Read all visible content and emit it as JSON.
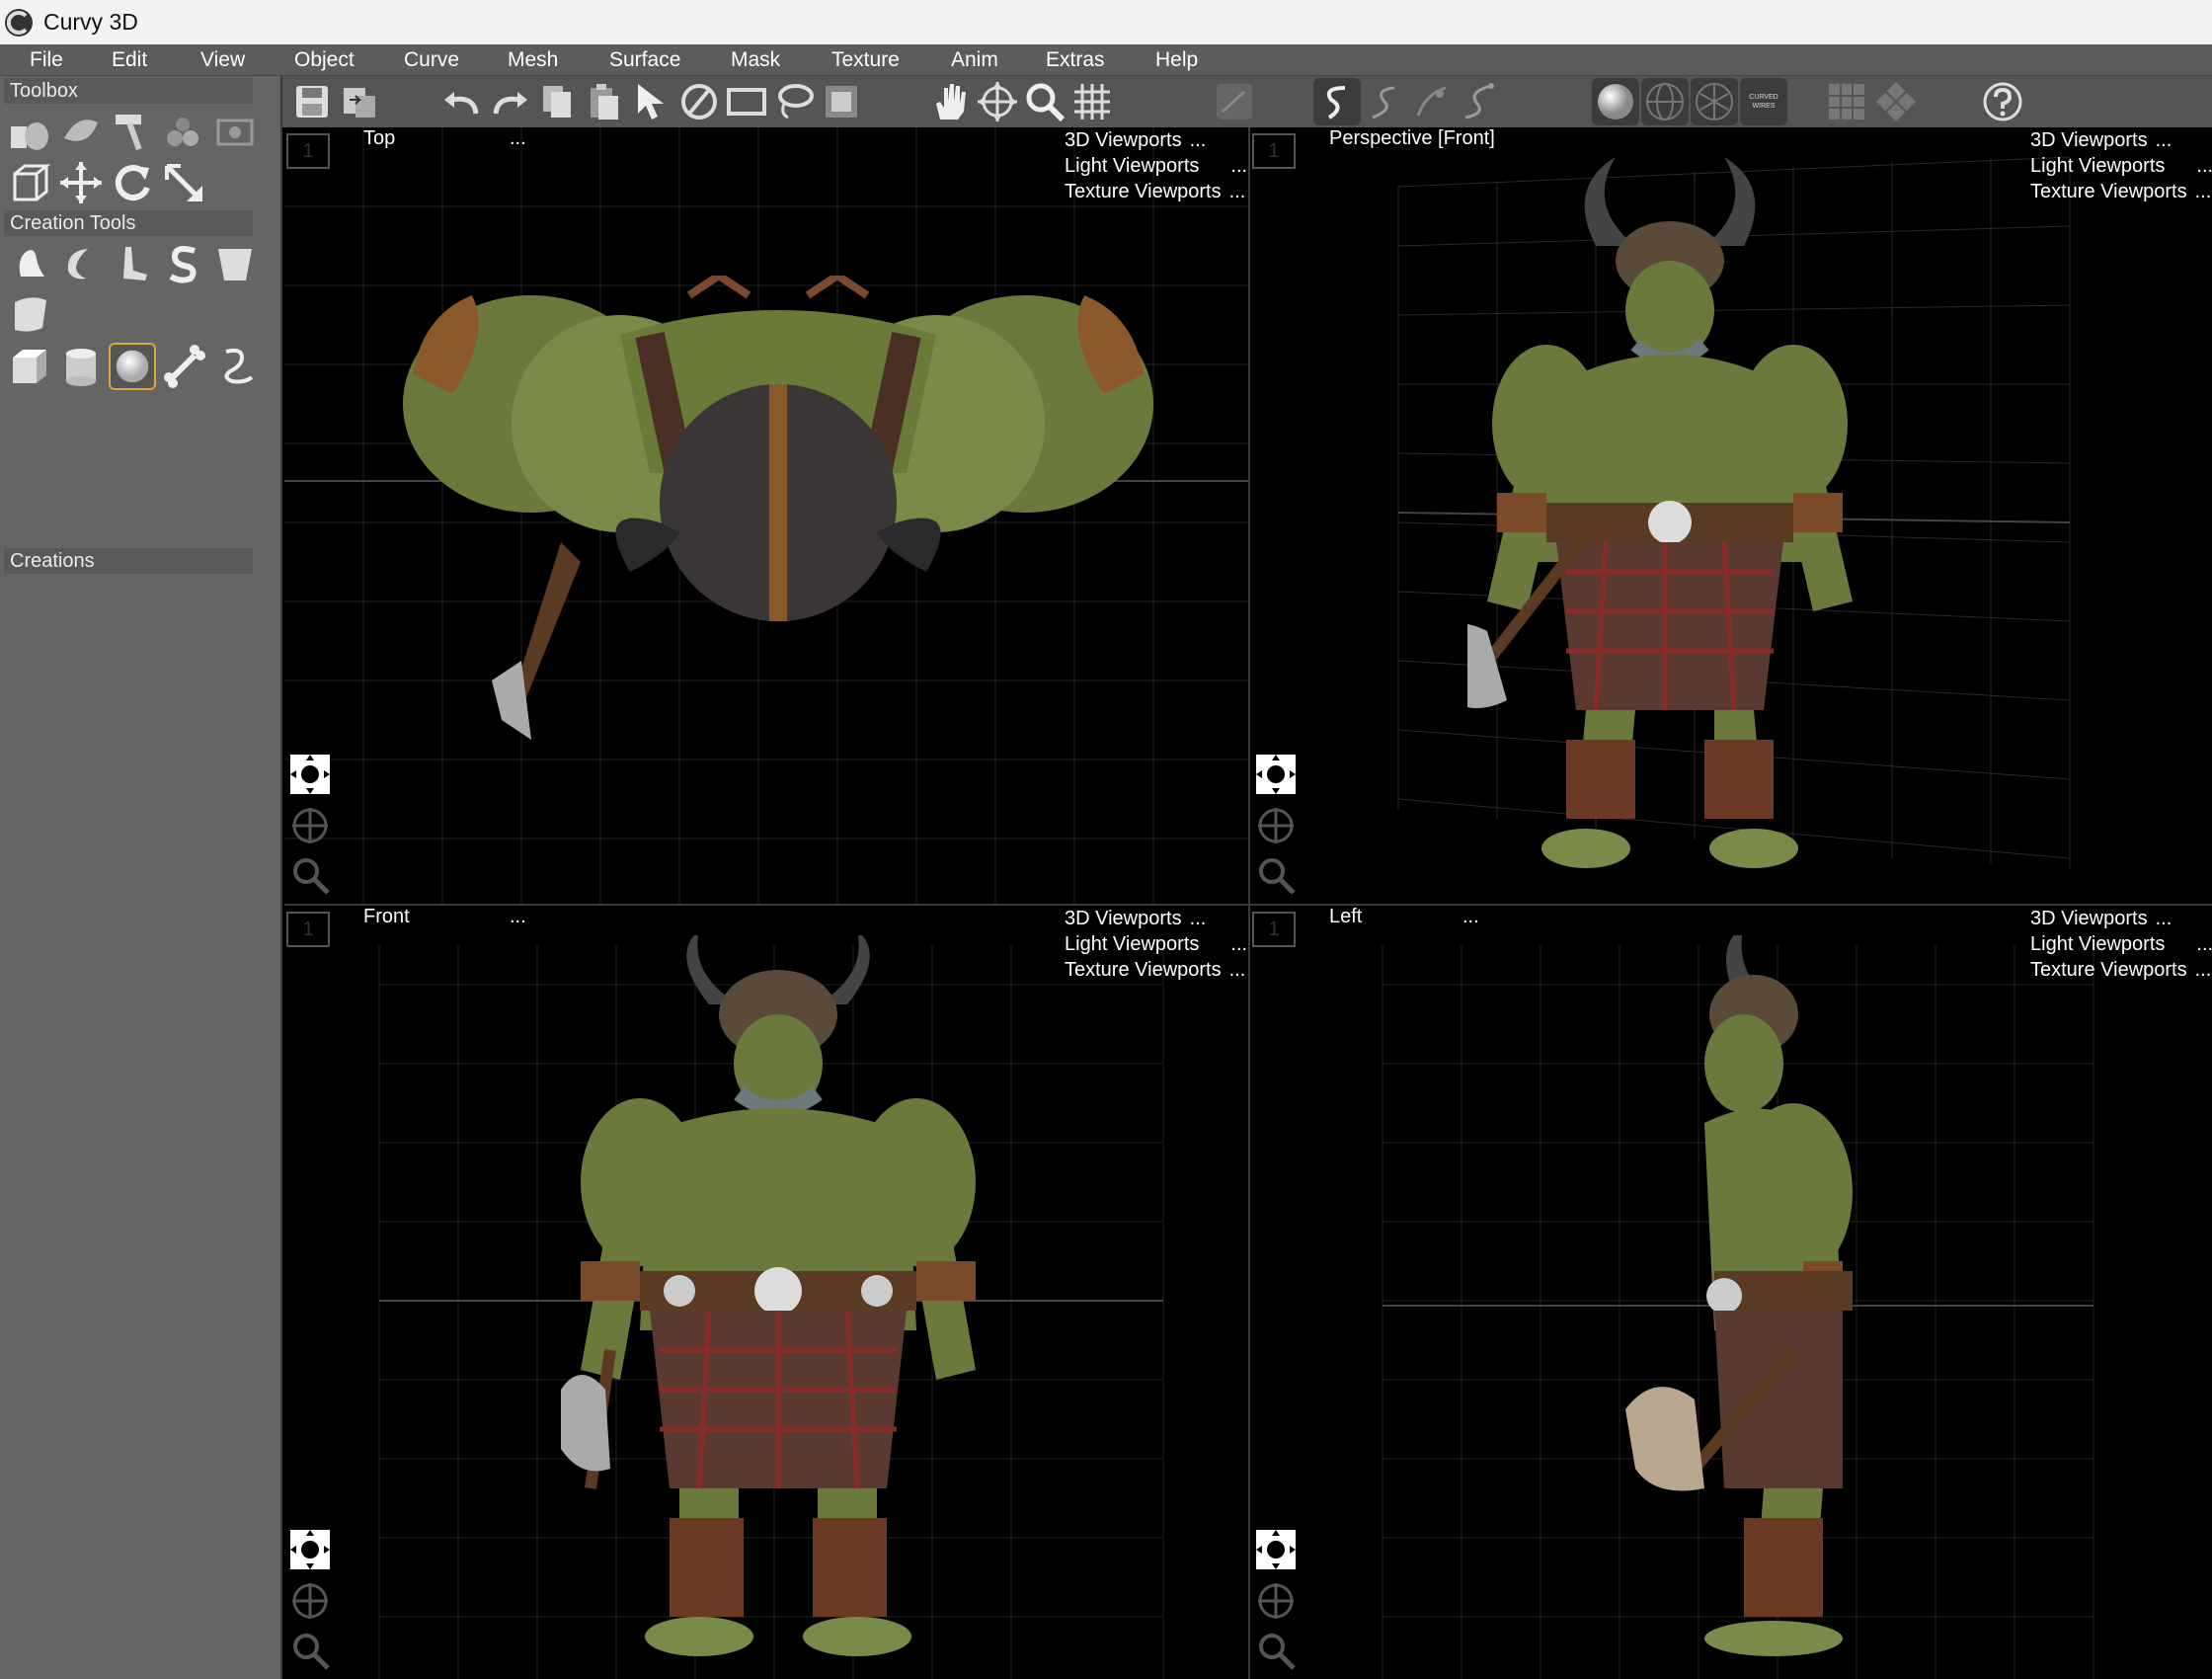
{
  "app": {
    "title": "Curvy 3D"
  },
  "menu": [
    "File",
    "Edit",
    "View",
    "Object",
    "Curve",
    "Mesh",
    "Surface",
    "Mask",
    "Texture",
    "Anim",
    "Extras",
    "Help"
  ],
  "sidebar": {
    "toolbox_label": "Toolbox",
    "creation_tools_label": "Creation Tools",
    "creations_label": "Creations"
  },
  "viewports": {
    "top_left": {
      "label": "Top",
      "ellipsis": "...",
      "number": "1"
    },
    "top_right": {
      "label": "Perspective [Front]",
      "ellipsis": "",
      "number": "1"
    },
    "bottom_left": {
      "label": "Front",
      "ellipsis": "...",
      "number": "1"
    },
    "bottom_right": {
      "label": "Left",
      "ellipsis": "...",
      "number": "1"
    },
    "menu_3d": "3D Viewports",
    "menu_light": "Light Viewports",
    "menu_texture": "Texture Viewports",
    "menu_suffix": "..."
  },
  "toolbar": {
    "wires_label": "CURVED WIRES"
  },
  "colors": {
    "skin": "#6b7a3c",
    "armor": "#8a5a2a",
    "kilt": "#5a3a30",
    "bg": "#000000"
  }
}
